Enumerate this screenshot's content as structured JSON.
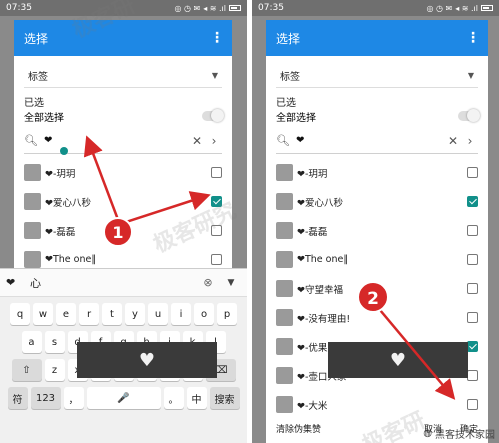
{
  "left": {
    "status": {
      "time": "07:35",
      "icons": "◎ ◷ ✉",
      "signal": "◂ ≋ .ıl"
    },
    "dialog_title": "选择",
    "tag_select": "标签",
    "selected_label": "已选",
    "select_all_label": "全部选择",
    "search_query": "❤",
    "items": [
      {
        "label": "❤-玥玥",
        "checked": false
      },
      {
        "label": "❤爱心八秒",
        "checked": true
      },
      {
        "label": "❤-磊磊",
        "checked": false
      },
      {
        "label": "❤The one‖",
        "checked": false
      }
    ],
    "keyboard": {
      "candidates": [
        "❤",
        "心"
      ],
      "row1": [
        "q",
        "w",
        "e",
        "r",
        "t",
        "y",
        "u",
        "i",
        "o",
        "p"
      ],
      "row2": [
        "a",
        "s",
        "d",
        "f",
        "g",
        "h",
        "j",
        "k",
        "l"
      ],
      "row3": [
        "z",
        "x",
        "c",
        "v",
        "b",
        "n",
        "m"
      ],
      "row4": {
        "symbols": "符",
        "num": "123",
        "comma": "，",
        "mic": "🎤",
        "period": "。",
        "zh": "中",
        "search": "搜索"
      },
      "popup_glyph": "♥"
    },
    "annotation_number": "1"
  },
  "right": {
    "status": {
      "time": "07:35",
      "icons": "◎ ◷ ✉",
      "signal": "◂ ≋ .ıl"
    },
    "dialog_title": "选择",
    "tag_select": "标签",
    "selected_label": "已选",
    "select_all_label": "全部选择",
    "search_query": "❤",
    "items": [
      {
        "label": "❤-玥玥",
        "checked": false
      },
      {
        "label": "❤爱心八秒",
        "checked": true
      },
      {
        "label": "❤-磊磊",
        "checked": false
      },
      {
        "label": "❤The one‖",
        "checked": false
      },
      {
        "label": "❤守望幸福",
        "checked": false
      },
      {
        "label": "❤-没有理由!",
        "checked": false
      },
      {
        "label": "❤-优果爱罐头代理",
        "checked": true
      },
      {
        "label": "❤-壶口人家",
        "checked": false
      },
      {
        "label": "❤-大米",
        "checked": false
      }
    ],
    "popup_glyph": "♥",
    "footer": {
      "clear_fake": "清除伪集赞",
      "cancel": "取消",
      "confirm": "确定"
    },
    "annotation_number": "2"
  },
  "watermarks": [
    "极客研",
    "极客研究",
    "极客研"
  ],
  "brand": "黑客技术家园",
  "colors": {
    "header": "#1e88e5",
    "accent": "#11908a",
    "annotation": "#d62828"
  }
}
